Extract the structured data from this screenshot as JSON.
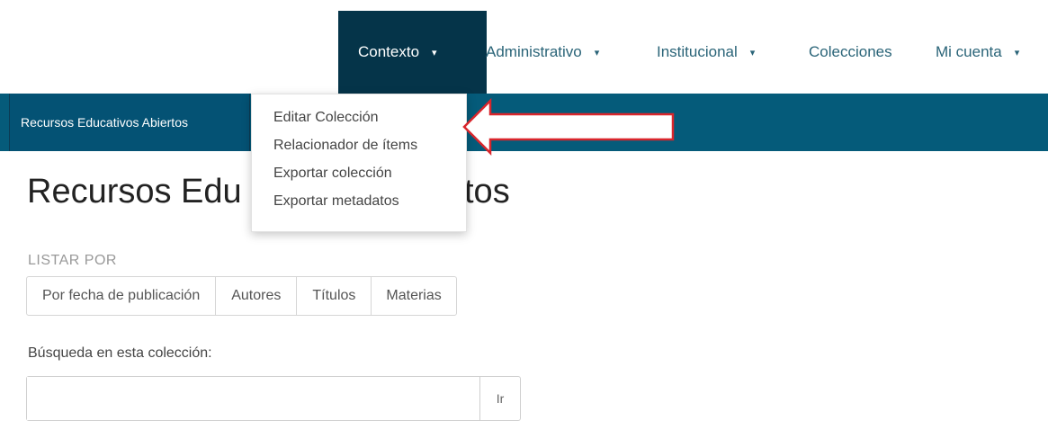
{
  "nav": {
    "items": [
      {
        "label": "Contexto",
        "caret": "▾"
      },
      {
        "label": "Administrativo",
        "caret": "▾"
      },
      {
        "label": "Institucional",
        "caret": "▾"
      },
      {
        "label": "Colecciones"
      },
      {
        "label": "Mi cuenta",
        "caret": "▾"
      }
    ]
  },
  "breadcrumb": {
    "label": "Recursos Educativos Abiertos"
  },
  "dropdown": {
    "items": [
      {
        "label": "Editar Colección"
      },
      {
        "label": "Relacionador de ítems"
      },
      {
        "label": "Exportar colección"
      },
      {
        "label": "Exportar metadatos"
      }
    ]
  },
  "page": {
    "title_visible_start": "Recursos Edu",
    "title_visible_end": "tos"
  },
  "browse": {
    "label": "LISTAR POR",
    "buttons": [
      {
        "label": "Por fecha de publicación"
      },
      {
        "label": "Autores"
      },
      {
        "label": "Títulos"
      },
      {
        "label": "Materias"
      }
    ]
  },
  "search": {
    "label": "Búsqueda en esta colección:",
    "value": "",
    "button_label": "Ir"
  },
  "colors": {
    "nav_active_bg": "#053449",
    "brand_bar": "#055b7a",
    "annotation_arrow": "#d9262c"
  }
}
